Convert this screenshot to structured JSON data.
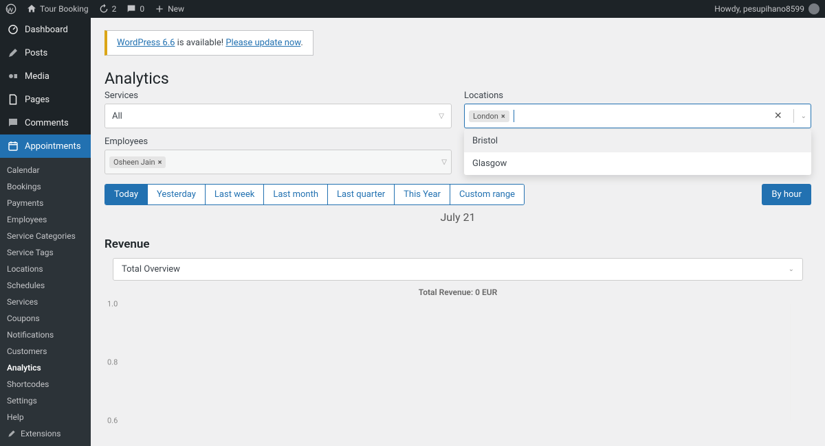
{
  "topbar": {
    "site_name": "Tour Booking",
    "updates": "2",
    "comments": "0",
    "new": "New",
    "howdy": "Howdy, pesupihano8599"
  },
  "sidebar": {
    "dashboard": "Dashboard",
    "posts": "Posts",
    "media": "Media",
    "pages": "Pages",
    "comments": "Comments",
    "appointments": "Appointments",
    "sub": {
      "calendar": "Calendar",
      "bookings": "Bookings",
      "payments": "Payments",
      "employees": "Employees",
      "service_categories": "Service Categories",
      "service_tags": "Service Tags",
      "locations": "Locations",
      "schedules": "Schedules",
      "services": "Services",
      "coupons": "Coupons",
      "notifications": "Notifications",
      "customers": "Customers",
      "analytics": "Analytics",
      "shortcodes": "Shortcodes",
      "settings": "Settings",
      "help": "Help",
      "extensions": "Extensions"
    }
  },
  "notice": {
    "link1": "WordPress 6.6",
    "mid": " is available! ",
    "link2": "Please update now",
    "end": "."
  },
  "page": {
    "title": "Analytics",
    "services_label": "Services",
    "services_value": "All",
    "locations_label": "Locations",
    "location_chip": "London",
    "employees_label": "Employees",
    "employee_chip": "Osheen Jain",
    "dropdown_opt1": "Bristol",
    "dropdown_opt2": "Glasgow",
    "range": {
      "today": "Today",
      "yesterday": "Yesterday",
      "last_week": "Last week",
      "last_month": "Last month",
      "last_quarter": "Last quarter",
      "this_year": "This Year",
      "custom": "Custom range"
    },
    "byhour": "By hour",
    "date_display": "July 21",
    "revenue_title": "Revenue",
    "overview_select": "Total Overview"
  },
  "chart_data": {
    "type": "line",
    "title": "Total Revenue: 0 EUR",
    "ylabel": "",
    "ylim": [
      0,
      1.0
    ],
    "y_ticks": [
      "1.0",
      "0.8",
      "0.6"
    ],
    "categories": [],
    "values": []
  }
}
